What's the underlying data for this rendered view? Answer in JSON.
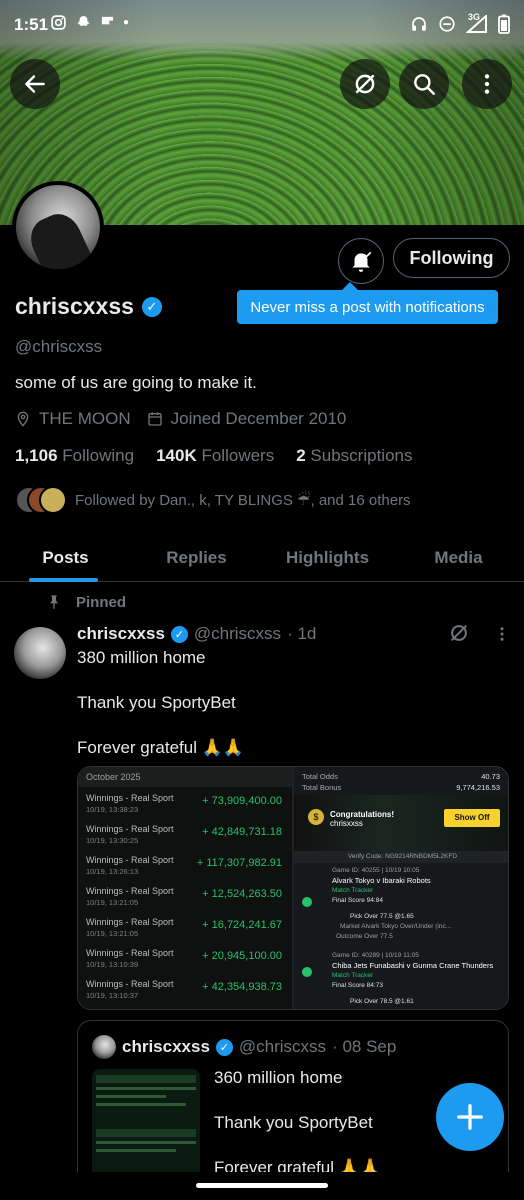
{
  "status_bar": {
    "time": "1:51",
    "network": "3G",
    "app_icons": [
      "instagram-icon",
      "snapchat-icon",
      "flipboard-icon",
      "dot-icon"
    ],
    "right_icons": [
      "headphones-icon",
      "dnd-icon",
      "signal-icon",
      "battery-icon"
    ]
  },
  "header": {
    "back_icon": "arrow-left-icon",
    "grok_icon": "grok-icon",
    "search_icon": "search-icon",
    "more_icon": "more-vertical-icon"
  },
  "profile": {
    "display_name": "chriscxxss",
    "handle": "@chriscxss",
    "bio": "some of us are going to make it.",
    "location": "THE MOON",
    "joined": "Joined December 2010",
    "following_count": "1,106",
    "following_label": "Following",
    "followers_count": "140K",
    "followers_label": "Followers",
    "subscriptions_count": "2",
    "subscriptions_label": "Subscriptions",
    "followed_by": "Followed by Dan., k, TY BLINGS ☔, and 16 others",
    "follow_button": "Following",
    "tooltip": "Never miss a post with notifications"
  },
  "tabs": [
    {
      "label": "Posts",
      "active": true
    },
    {
      "label": "Replies",
      "active": false
    },
    {
      "label": "Highlights",
      "active": false
    },
    {
      "label": "Media",
      "active": false
    }
  ],
  "post": {
    "pinned_label": "Pinned",
    "name": "chriscxxss",
    "handle": "@chriscxss",
    "time": "· 1d",
    "text": "380 million home\n\nThank you SportyBet\n\nForever grateful 🙏🙏",
    "image_left": {
      "header": "October 2025",
      "rows": [
        {
          "label": "Winnings - Real Sport",
          "date": "10/19, 13:38:23",
          "amount": "+ 73,909,400.00"
        },
        {
          "label": "Winnings - Real Sport",
          "date": "10/19, 13:30:25",
          "amount": "+ 42,849,731.18"
        },
        {
          "label": "Winnings - Real Sport",
          "date": "10/19, 13:26:13",
          "amount": "+ 117,307,982.91"
        },
        {
          "label": "Winnings - Real Sport",
          "date": "10/19, 13:21:05",
          "amount": "+ 12,524,263.50"
        },
        {
          "label": "Winnings - Real Sport",
          "date": "10/19, 13:21:05",
          "amount": "+ 16,724,241.67"
        },
        {
          "label": "Winnings - Real Sport",
          "date": "10/19, 13:10:39",
          "amount": "+ 20,945,100.00"
        },
        {
          "label": "Winnings - Real Sport",
          "date": "10/19, 13:10:37",
          "amount": "+ 42,354,938.73"
        }
      ]
    },
    "image_right": {
      "total_odds_label": "Total Odds",
      "total_odds": "40.73",
      "total_bonus_label": "Total Bonus",
      "total_bonus": "9,774,216.53",
      "congrats": "Congratulations!",
      "user": "chrisxxss",
      "show_off": "Show Off",
      "verify": "Verify Code: NG9214RNBDM5L2KFD",
      "game1_id": "Game ID: 40255 | 10/19 10:05",
      "game1_match": "Alvark Tokyo v Ibaraki Robots",
      "match_tracker": "Match Tracker",
      "game1_score": "Final Score  94:84",
      "game1_pick": "Pick  Over 77.5 @1.65",
      "game1_market": "Market  Alvark Tokyo Over/Under (inc...",
      "game1_outcome": "Outcome  Over 77.5",
      "game2_id": "Game ID: 40289 | 10/19 11:05",
      "game2_match": "Chiba Jets Funabashi v Gunma Crane Thunders",
      "game2_score": "Final Score  84:73",
      "game2_pick": "Pick  Over 78.5 @1.61"
    }
  },
  "quote": {
    "name": "chriscxxss",
    "handle": "@chriscxss",
    "time": "· 08 Sep",
    "text": "360 million home\n\nThank you SportyBet\n\nForever grateful 🙏🙏"
  },
  "fab_icon": "plus-icon"
}
